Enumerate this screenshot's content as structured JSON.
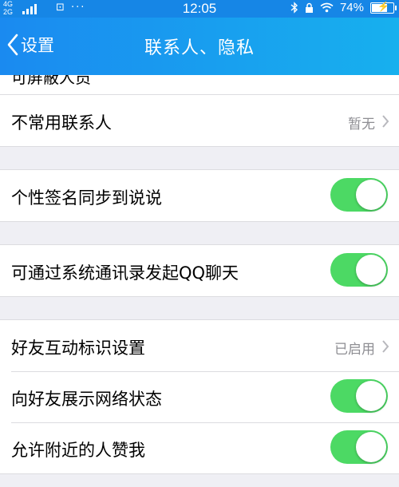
{
  "status_bar": {
    "network_top": "4G",
    "network_bottom": "2G",
    "notification_icons": "⊡ ···",
    "time": "12:05",
    "battery_percent": "74%",
    "battery_level": 0.74
  },
  "nav": {
    "back_label": "设置",
    "title": "联系人、隐私"
  },
  "partial_row_label": "可屏蔽人员",
  "groups": [
    {
      "rows": [
        {
          "label": "不常用联系人",
          "value": "暂无",
          "type": "link"
        }
      ]
    },
    {
      "rows": [
        {
          "label": "个性签名同步到说说",
          "type": "switch",
          "on": true
        }
      ]
    },
    {
      "rows": [
        {
          "label": "可通过系统通讯录发起QQ聊天",
          "type": "switch",
          "on": true
        }
      ]
    },
    {
      "rows": [
        {
          "label": "好友互动标识设置",
          "value": "已启用",
          "type": "link"
        },
        {
          "label": "向好友展示网络状态",
          "type": "switch",
          "on": true
        },
        {
          "label": "允许附近的人赞我",
          "type": "switch",
          "on": true
        }
      ]
    }
  ],
  "colors": {
    "nav_start": "#1a8af0",
    "nav_end": "#17b0ee",
    "switch_on": "#4cd964",
    "background": "#efeff4"
  },
  "icons": [
    "signal-icon",
    "bluetooth-icon",
    "lock-icon",
    "wifi-icon",
    "battery-icon",
    "back-chevron-icon",
    "chevron-right-icon"
  ]
}
